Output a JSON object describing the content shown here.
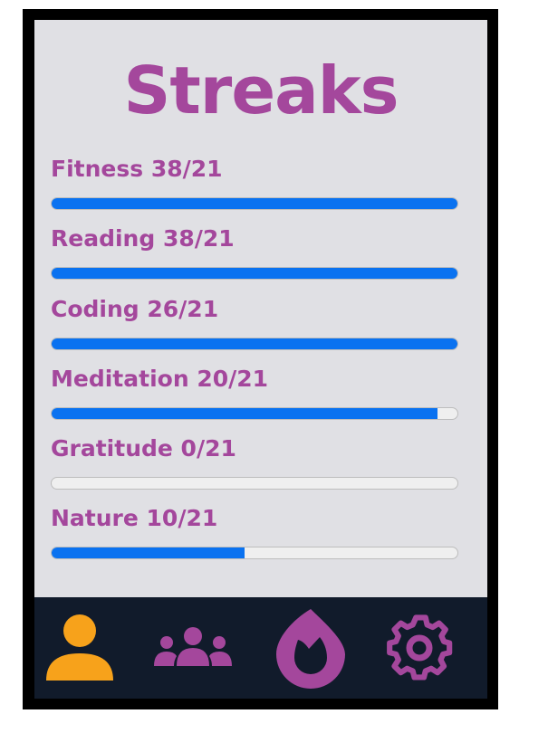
{
  "title": "Streaks",
  "colors": {
    "title": "#a4479c",
    "bar_fill": "#0a72f0",
    "bar_track": "#efefef",
    "screen_bg": "#e0e0e4",
    "navbar_bg": "#111b2b",
    "active_tab": "#f7a21b",
    "inactive_tab": "#a4479c"
  },
  "streaks": [
    {
      "label": "Fitness 38/21",
      "progress": 1.0
    },
    {
      "label": "Reading 38/21",
      "progress": 1.0
    },
    {
      "label": "Coding 26/21",
      "progress": 1.0
    },
    {
      "label": "Meditation 20/21",
      "progress": 0.952
    },
    {
      "label": "Gratitude 0/21",
      "progress": 0.0
    },
    {
      "label": "Nature 10/21",
      "progress": 0.476
    }
  ],
  "nav": [
    {
      "icon": "user-icon",
      "active": true
    },
    {
      "icon": "group-icon",
      "active": false
    },
    {
      "icon": "flame-icon",
      "active": false
    },
    {
      "icon": "gear-icon",
      "active": false
    }
  ]
}
